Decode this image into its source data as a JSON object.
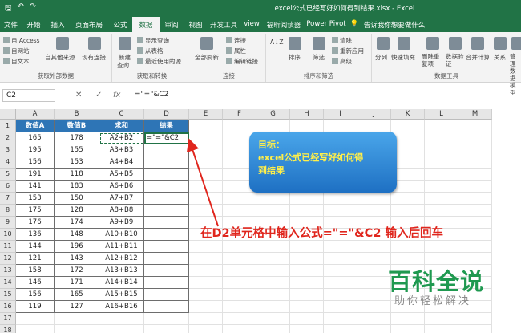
{
  "qat": {
    "save": "🖫",
    "undo": "↶",
    "redo": "↷"
  },
  "title": "excel公式已经写好如何得到结果.xlsx - Excel",
  "tabs": [
    "文件",
    "开始",
    "插入",
    "页面布局",
    "公式",
    "数据",
    "审阅",
    "视图",
    "开发工具",
    "view",
    "福昕阅读器",
    "Power Pivot",
    "告诉我你想要做什么"
  ],
  "active_tab": "数据",
  "ribbon": {
    "ext": {
      "access": "自 Access",
      "web": "自网站",
      "text": "自文本",
      "other": "自其他来源",
      "existing": "现有连接",
      "label": "获取外部数据"
    },
    "transform": {
      "new_query": "新建",
      "query": "查询",
      "show": "显示查询",
      "table": "从表格",
      "recent": "最近使用的源",
      "label": "获取和转换"
    },
    "conn": {
      "refresh": "全部刷新",
      "connections": "连接",
      "props": "属性",
      "edit_links": "编辑链接",
      "label": "连接"
    },
    "sort": {
      "az": "A↓Z",
      "sort": "排序",
      "filter": "筛选",
      "clear": "清除",
      "reapply": "重新应用",
      "advanced": "高级",
      "label": "排序和筛选"
    },
    "tools": {
      "split": "分列",
      "flash": "快速填充",
      "dup": "删除重复项",
      "valid": "数据验证",
      "merge": "合并计算",
      "rel": "关系",
      "manage": "管理数据模型",
      "label": "数据工具"
    }
  },
  "formula": {
    "name": "C2",
    "cancel": "✕",
    "enter": "✓",
    "fx": "fx",
    "content": "=\"=\"&C2"
  },
  "columns": [
    "A",
    "B",
    "C",
    "D",
    "E",
    "F",
    "G",
    "H",
    "I",
    "J",
    "K",
    "L",
    "M"
  ],
  "rows": [
    "1",
    "2",
    "3",
    "4",
    "5",
    "6",
    "7",
    "8",
    "9",
    "10",
    "11",
    "12",
    "13",
    "14",
    "15",
    "16",
    "17",
    "18"
  ],
  "table": {
    "headers": [
      "数值A",
      "数值B",
      "求和",
      "结果"
    ],
    "data": [
      [
        "165",
        "178",
        "A2+B2",
        "=\"=\"&C2"
      ],
      [
        "195",
        "155",
        "A3+B3",
        ""
      ],
      [
        "156",
        "153",
        "A4+B4",
        ""
      ],
      [
        "191",
        "118",
        "A5+B5",
        ""
      ],
      [
        "141",
        "183",
        "A6+B6",
        ""
      ],
      [
        "153",
        "150",
        "A7+B7",
        ""
      ],
      [
        "175",
        "128",
        "A8+B8",
        ""
      ],
      [
        "176",
        "174",
        "A9+B9",
        ""
      ],
      [
        "136",
        "148",
        "A10+B10",
        ""
      ],
      [
        "144",
        "196",
        "A11+B11",
        ""
      ],
      [
        "121",
        "143",
        "A12+B12",
        ""
      ],
      [
        "158",
        "172",
        "A13+B13",
        ""
      ],
      [
        "146",
        "171",
        "A14+B14",
        ""
      ],
      [
        "156",
        "165",
        "A15+B15",
        ""
      ],
      [
        "119",
        "127",
        "A16+B16",
        ""
      ]
    ]
  },
  "callout": {
    "heading": "目标：",
    "line1": "excel公式已经写好如何得",
    "line2": "到结果"
  },
  "instruction": "在D2单元格中输入公式=\"=\"&C2 输入后回车",
  "watermark": {
    "title": "百科全说",
    "subtitle": "助你轻松解决"
  },
  "colors": {
    "excel_green": "#217346",
    "header_blue": "#2e75b6",
    "arrow_red": "#e0261d",
    "watermark_green": "#1f9950"
  }
}
